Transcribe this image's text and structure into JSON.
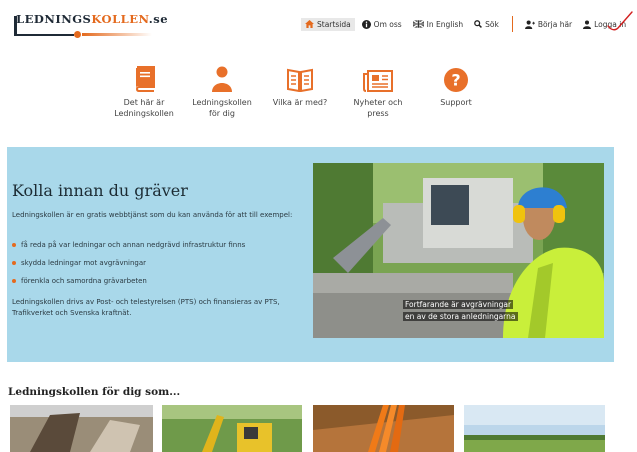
{
  "brand": {
    "part1": "LEDNINGS",
    "part2": "KOLLEN",
    "suffix": ".se",
    "accent": "#e46a1e",
    "dark": "#1f2a36"
  },
  "topnav": {
    "items": [
      {
        "label": "Startsida",
        "icon": "home-icon",
        "active": true
      },
      {
        "label": "Om oss",
        "icon": "info-icon"
      },
      {
        "label": "In English",
        "icon": "uk-flag-icon"
      },
      {
        "label": "Sök",
        "icon": "search-icon"
      }
    ],
    "account": [
      {
        "label": "Börja här",
        "icon": "add-user-icon"
      },
      {
        "label": "Logga in",
        "icon": "user-icon"
      }
    ]
  },
  "iconnav": [
    {
      "label": "Det här är Ledningskollen",
      "icon": "book-icon"
    },
    {
      "label": "Ledningskollen för dig",
      "icon": "person-icon"
    },
    {
      "label": "Vilka är med?",
      "icon": "open-book-icon"
    },
    {
      "label": "Nyheter och press",
      "icon": "newspaper-icon"
    },
    {
      "label": "Support",
      "icon": "question-icon"
    }
  ],
  "hero": {
    "bg": "#a9d8ea",
    "title": "Kolla innan du gräver",
    "intro": "Ledningskollen är en gratis webbtjänst som du kan använda för att till exempel:",
    "bullets": [
      "få reda på var ledningar och annan nedgrävd infrastruktur finns",
      "skydda ledningar mot avgrävningar",
      "förenkla och samordna grävarbeten"
    ],
    "footer": "Ledningskollen drivs av Post- och telestyrelsen (PTS) och finansieras av PTS, Trafikverket och Svenska kraftnät.",
    "caption_line1": "Fortfarande är avgrävningar",
    "caption_line2": "en av de stora anledningarna"
  },
  "section": {
    "title": "Ledningskollen för dig som..."
  }
}
